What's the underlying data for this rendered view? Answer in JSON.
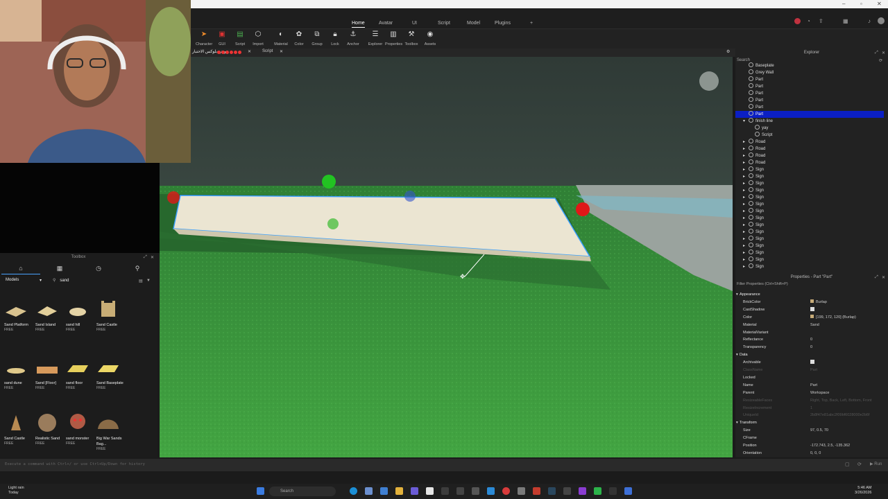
{
  "menubar": {
    "tabs": [
      "Home",
      "Avatar",
      "UI",
      "Script",
      "Model",
      "Plugins",
      "+"
    ],
    "active": "Home"
  },
  "toolbar": {
    "tools": [
      "Character",
      "GUI",
      "Script",
      "Import",
      "Material",
      "Color",
      "Group",
      "Lock",
      "Anchor",
      "Explorer",
      "Properties",
      "Toolbox",
      "Assets"
    ]
  },
  "doctabs": {
    "place_tab": "وضع بلوكس الاختبار",
    "script_tab": "Script"
  },
  "toolbox": {
    "title": "Toolbox",
    "category": "Models",
    "search": "sand",
    "assets": [
      {
        "name": "Sand Platform",
        "price": "FREE"
      },
      {
        "name": "Sand Island",
        "price": "FREE"
      },
      {
        "name": "sand hill",
        "price": "FREE"
      },
      {
        "name": "Sand Castle",
        "price": "FREE"
      },
      {
        "name": "sand dune",
        "price": "FREE"
      },
      {
        "name": "Sand [Floor]",
        "price": "FREE"
      },
      {
        "name": "sand floor",
        "price": "FREE"
      },
      {
        "name": "Sand Baseplate",
        "price": "FREE"
      },
      {
        "name": "Sand Castle",
        "price": "FREE"
      },
      {
        "name": "Realistic Sand",
        "price": "FREE"
      },
      {
        "name": "sand monster",
        "price": "FREE"
      },
      {
        "name": "Big War Sands Bag...",
        "price": "FREE"
      }
    ]
  },
  "explorer": {
    "title": "Explorer",
    "search": "Search",
    "items": [
      {
        "label": "Baseplate",
        "indent": 1
      },
      {
        "label": "Grey Wall",
        "indent": 1
      },
      {
        "label": "Part",
        "indent": 1
      },
      {
        "label": "Part",
        "indent": 1
      },
      {
        "label": "Part",
        "indent": 1
      },
      {
        "label": "Part",
        "indent": 1
      },
      {
        "label": "Part",
        "indent": 1
      },
      {
        "label": "Part",
        "indent": 1,
        "selected": true
      },
      {
        "label": "finish line",
        "indent": 1,
        "expand": "▾"
      },
      {
        "label": "yay",
        "indent": 2
      },
      {
        "label": "Script",
        "indent": 2
      },
      {
        "label": "Road",
        "indent": 1,
        "expand": "▸"
      },
      {
        "label": "Road",
        "indent": 1,
        "expand": "▸"
      },
      {
        "label": "Road",
        "indent": 1,
        "expand": "▸"
      },
      {
        "label": "Road",
        "indent": 1,
        "expand": "▸"
      },
      {
        "label": "Sign",
        "indent": 1,
        "expand": "▸"
      },
      {
        "label": "Sign",
        "indent": 1,
        "expand": "▸"
      },
      {
        "label": "Sign",
        "indent": 1,
        "expand": "▸"
      },
      {
        "label": "Sign",
        "indent": 1,
        "expand": "▸"
      },
      {
        "label": "Sign",
        "indent": 1,
        "expand": "▸"
      },
      {
        "label": "Sign",
        "indent": 1,
        "expand": "▸"
      },
      {
        "label": "Sign",
        "indent": 1,
        "expand": "▸"
      },
      {
        "label": "Sign",
        "indent": 1,
        "expand": "▸"
      },
      {
        "label": "Sign",
        "indent": 1,
        "expand": "▸"
      },
      {
        "label": "Sign",
        "indent": 1,
        "expand": "▸"
      },
      {
        "label": "Sign",
        "indent": 1,
        "expand": "▸"
      },
      {
        "label": "Sign",
        "indent": 1,
        "expand": "▸"
      },
      {
        "label": "Sign",
        "indent": 1,
        "expand": "▸"
      },
      {
        "label": "Sign",
        "indent": 1,
        "expand": "▸"
      },
      {
        "label": "Sign",
        "indent": 1,
        "expand": "▸"
      }
    ]
  },
  "properties": {
    "title": "Properties - Part \"Part\"",
    "filter": "Filter Properties (Ctrl+Shift+P)",
    "rows": [
      {
        "type": "sec",
        "key": "Appearance"
      },
      {
        "key": "BrickColor",
        "value": "Burlap",
        "swatch": true
      },
      {
        "key": "CastShadow",
        "check": true
      },
      {
        "key": "Color",
        "value": "[199, 172, 120] (Burlap)",
        "swatch": true
      },
      {
        "key": "Material",
        "value": "Sand"
      },
      {
        "key": "MaterialVariant",
        "value": ""
      },
      {
        "key": "Reflectance",
        "value": "0"
      },
      {
        "key": "Transparency",
        "value": "0"
      },
      {
        "type": "sec",
        "key": "Data"
      },
      {
        "key": "Archivable",
        "check": true
      },
      {
        "key": "ClassName",
        "value": "Part",
        "dim": true
      },
      {
        "key": "Locked",
        "value": ""
      },
      {
        "key": "Name",
        "value": "Part"
      },
      {
        "key": "Parent",
        "value": "Workspace"
      },
      {
        "key": "ResizeableFaces",
        "value": "Right, Top, Back, Left, Bottom, Front",
        "dim": true
      },
      {
        "key": "ResizeIncrement",
        "value": "1",
        "dim": true
      },
      {
        "key": "UniqueId",
        "value": "2b8f47e81abc2f09bf6028000e2b6f",
        "dim": true
      },
      {
        "type": "sec",
        "key": "Transform"
      },
      {
        "key": "Size",
        "value": "97, 0.5, 70"
      },
      {
        "key": "CFrame",
        "value": ""
      },
      {
        "key": "Position",
        "value": "-172.743, 2.5, -135.362"
      },
      {
        "key": "Orientation",
        "value": "0, 0, 0"
      }
    ]
  },
  "cmdbar": {
    "placeholder": "Execute a command with Ctrl+/ or use Ctrl+Up/Down for history"
  },
  "taskbar": {
    "weather_line1": "Light rain",
    "weather_line2": "Today",
    "search": "Search",
    "time": "5:46 AM",
    "date": "3/26/2026"
  },
  "colors": {
    "selection": "#0b1fc4",
    "grass": "#3f9a3c",
    "sand": "#e8e2cf",
    "handle_green": "#22c322",
    "handle_red": "#e01818",
    "handle_blue": "#3355cc"
  }
}
